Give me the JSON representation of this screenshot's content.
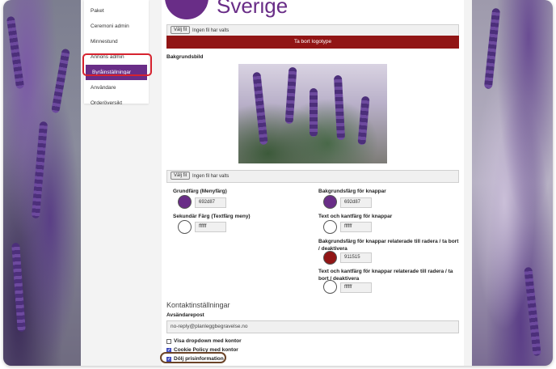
{
  "sidebar": {
    "items": [
      {
        "label": "Paket",
        "active": false
      },
      {
        "label": "Ceremoni admin",
        "active": false
      },
      {
        "label": "Minnestund",
        "active": false
      },
      {
        "label": "Annons admin",
        "active": false
      },
      {
        "label": "Byråinställningar",
        "active": true
      },
      {
        "label": "Användare",
        "active": false
      },
      {
        "label": "Orderöversikt",
        "active": false
      }
    ]
  },
  "header": {
    "title": "Sverige"
  },
  "logo_upload": {
    "button": "Välj fil",
    "status": "Ingen fil har valts"
  },
  "delete_logo_button": "Ta bort logotype",
  "background": {
    "label": "Bakgrundsbild",
    "upload_button": "Välj fil",
    "upload_status": "Ingen fil har valts"
  },
  "colors": {
    "primary": {
      "label": "Grundfärg (Menyfärg)",
      "value": "692d87",
      "hex": "#692d87"
    },
    "secondary": {
      "label": "Sekundär Färg (Textfärg meny)",
      "value": "ffffff",
      "hex": "#ffffff"
    },
    "button_bg": {
      "label": "Bakgrundsfärg för knappar",
      "value": "692d87",
      "hex": "#692d87"
    },
    "button_text": {
      "label": "Text och kantfärg för knappar",
      "value": "ffffff",
      "hex": "#ffffff"
    },
    "danger_bg": {
      "label": "Bakgrundsfärg för knappar relaterade till radera / ta bort / deaktivera",
      "value": "911515",
      "hex": "#911515"
    },
    "danger_text": {
      "label": "Text och kantfärg för knappar relaterade till radera / ta bort / deaktivera",
      "value": "ffffff",
      "hex": "#ffffff"
    }
  },
  "contact": {
    "section_title": "Kontaktinställningar",
    "sender_label": "Avsändarepost",
    "sender_value": "no-reply@planleggbegravelse.no"
  },
  "options": [
    {
      "label": "Visa dropdown med kontor",
      "checked": false
    },
    {
      "label": "Cookie Policy med kontor",
      "checked": true
    },
    {
      "label": "Dölj prisinformation",
      "checked": true
    }
  ]
}
